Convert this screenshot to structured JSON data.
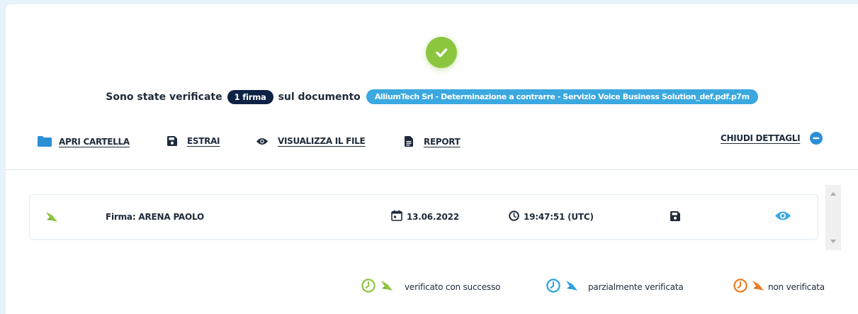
{
  "summary": {
    "prefix": "Sono state verificate",
    "signature_count": "1 firma",
    "middle": "sul documento",
    "filename": "AlliumTech Srl - Determinazione a contrarre - Servizio Voice Business Solution_def.pdf.p7m"
  },
  "toolbar": {
    "open_folder": "APRI CARTELLA",
    "extract": "ESTRAI",
    "view_file": "VISUALIZZA IL FILE",
    "report": "REPORT",
    "close_details": "CHIUDI DETTAGLI"
  },
  "signatures": [
    {
      "label": "Firma: ARENA PAOLO",
      "date": "13.06.2022",
      "time": "19:47:51 (UTC)",
      "status": "verified"
    }
  ],
  "legend": {
    "success": "verificato con successo",
    "partial": "parzialmente verificata",
    "failed": "non verificata"
  },
  "colors": {
    "success": "#8cc63f",
    "partial": "#2aa3dc",
    "failed": "#f07c1e",
    "navy": "#0d2245",
    "accent_blue": "#3ba8e0"
  }
}
